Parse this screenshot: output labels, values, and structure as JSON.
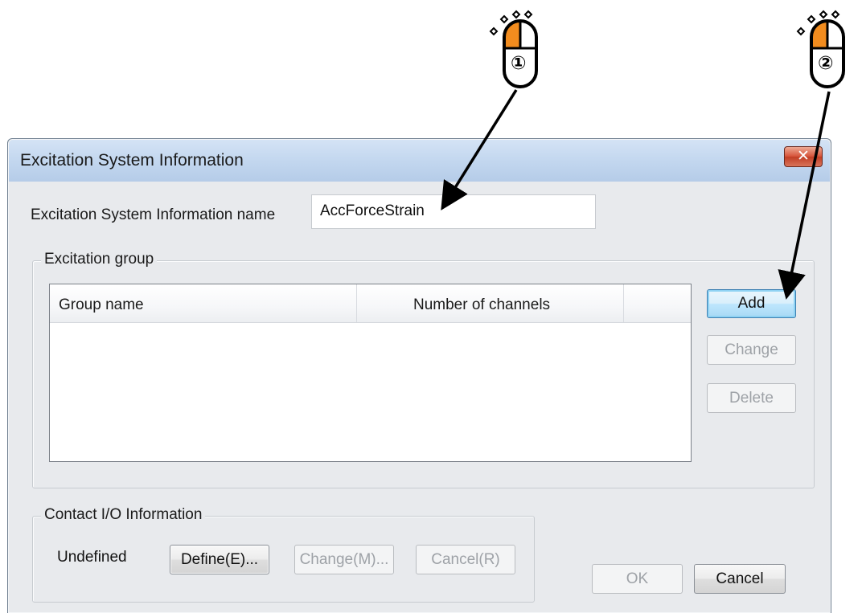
{
  "dialog": {
    "title": "Excitation System Information",
    "close_glyph": "✕",
    "name_label": "Excitation System Information name",
    "name_value": "AccForceStrain",
    "excitation_group": {
      "legend": "Excitation group",
      "columns": [
        "Group name",
        "Number of channels"
      ],
      "rows": [],
      "buttons": {
        "add": "Add",
        "change": "Change",
        "delete": "Delete"
      }
    },
    "contact_io": {
      "legend": "Contact I/O Information",
      "status": "Undefined",
      "buttons": {
        "define": "Define(E)...",
        "change": "Change(M)...",
        "cancel": "Cancel(R)"
      }
    },
    "footer": {
      "ok": "OK",
      "cancel": "Cancel"
    }
  },
  "annotations": {
    "step1": "①",
    "step2": "②"
  },
  "colors": {
    "mouse_button": "#f28c1e",
    "close_button": "#d7553c",
    "default_button_border": "#3c7fb1"
  }
}
